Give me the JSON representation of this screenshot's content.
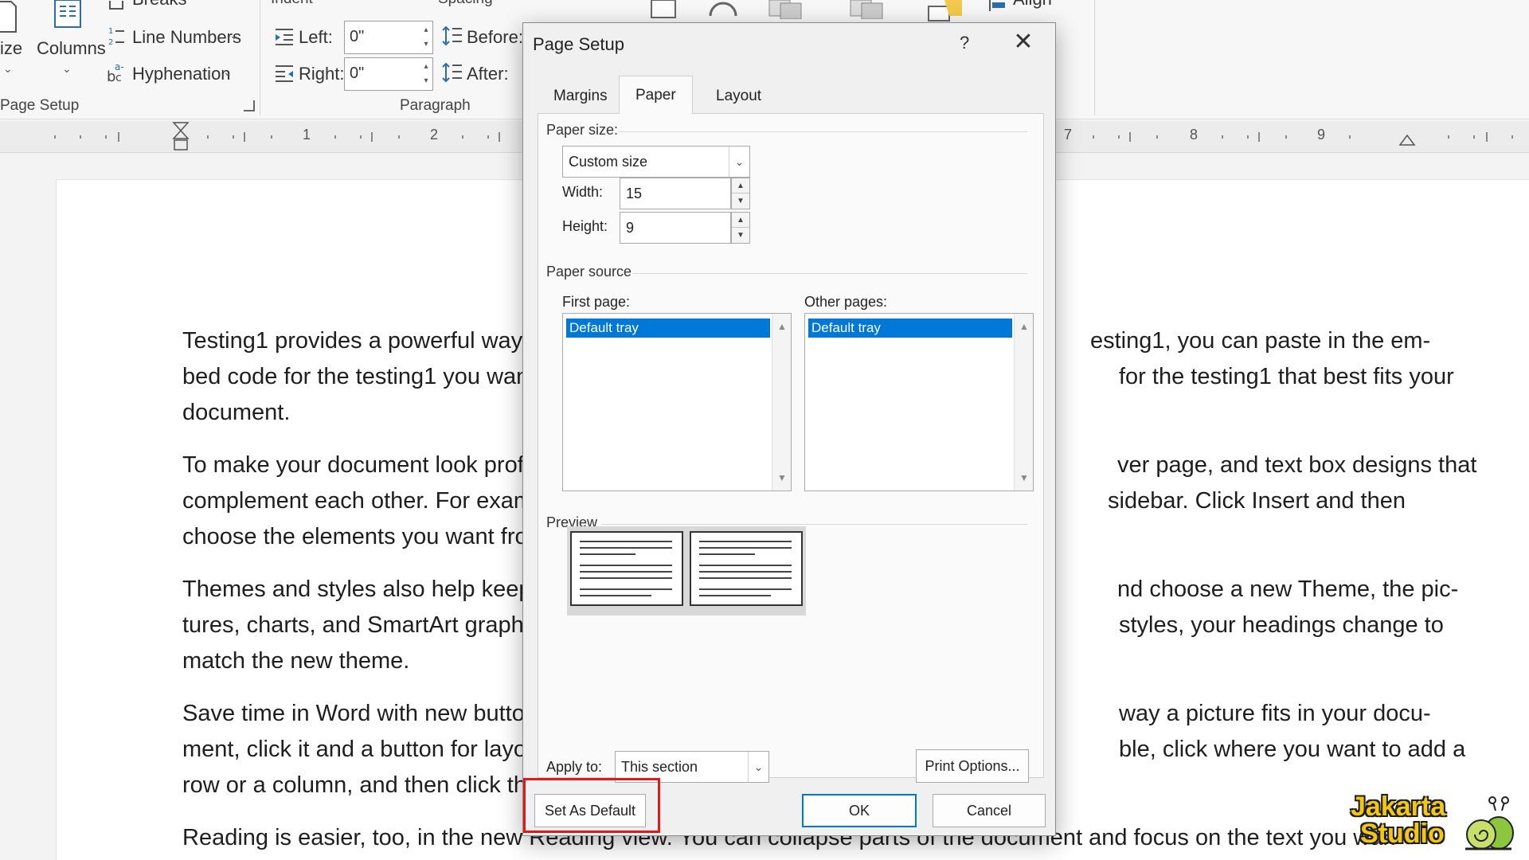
{
  "ribbon": {
    "size_label": "ize",
    "columns_label": "Columns",
    "breaks_label": "Breaks",
    "line_numbers_label": "Line Numbers",
    "hyphenation_label": "Hyphenation",
    "page_setup_group": "Page Setup",
    "indent_header": "Indent",
    "indent_left_label": "Left:",
    "indent_left_value": "0\"",
    "indent_right_label": "Right:",
    "indent_right_value": "0\"",
    "spacing_header": "Spacing",
    "spacing_before_label": "Before:",
    "spacing_after_label": "After:",
    "paragraph_group": "Paragraph",
    "align_label": "Align"
  },
  "ruler": {
    "numbers": [
      "1",
      "2",
      "7",
      "8",
      "9"
    ]
  },
  "document": {
    "p1": {
      "line1_left": "Testing1 provides a powerful way t",
      "line1_right": "esting1, you can paste in the em-",
      "line2_left": "bed code for the testing1 you wan",
      "line2_right": "for the testing1 that best fits your",
      "line3": "document."
    },
    "p2": {
      "line1_left": "To make your document look profe",
      "line1_right": "ver page, and text box designs that",
      "line2_left": "complement each other. For exam",
      "line2_right": "sidebar. Click Insert and then",
      "line3_left": "choose the elements you want fro"
    },
    "p3": {
      "line1_left": "Themes and styles also help keep y",
      "line1_right": "nd choose a new Theme, the pic-",
      "line2_left": "tures, charts, and SmartArt graphi",
      "line2_right": "styles, your headings change to",
      "line3": "match the new theme."
    },
    "p4": {
      "line1_left": "Save time in Word with new butto",
      "line1_right": "way a picture fits in your docu-",
      "line2_left": "ment, click it and a button for layo",
      "line2_right": "ble, click where you want to add a",
      "line3_left": "row or a column, and then click th"
    },
    "p5": {
      "line1": "Reading is easier, too, in the new Reading view. You can collapse parts of the document and focus on the text you wan"
    }
  },
  "dialog": {
    "title": "Page Setup",
    "help": "?",
    "close": "✕",
    "tabs": [
      {
        "label": "Margins",
        "active": false
      },
      {
        "label": "Paper",
        "active": true
      },
      {
        "label": "Layout",
        "active": false
      }
    ],
    "paper_size": {
      "section_label": "Paper size:",
      "selected": "Custom size",
      "width_label": "Width:",
      "width_value": "15",
      "height_label": "Height:",
      "height_value": "9"
    },
    "paper_source": {
      "section_label": "Paper source",
      "first_page_label": "First page:",
      "first_page_selected": "Default tray",
      "other_pages_label": "Other pages:",
      "other_pages_selected": "Default tray"
    },
    "preview_label": "Preview",
    "apply_to_label": "Apply to:",
    "apply_to_value": "This section",
    "print_options_label": "Print Options...",
    "set_as_default_label": "Set As Default",
    "ok_label": "OK",
    "cancel_label": "Cancel"
  },
  "watermark": {
    "line1": "Jakarta",
    "line2": "Studio"
  },
  "colors": {
    "selection": "#0078d7",
    "highlight": "#e01919",
    "watermark": "#f2c612"
  }
}
